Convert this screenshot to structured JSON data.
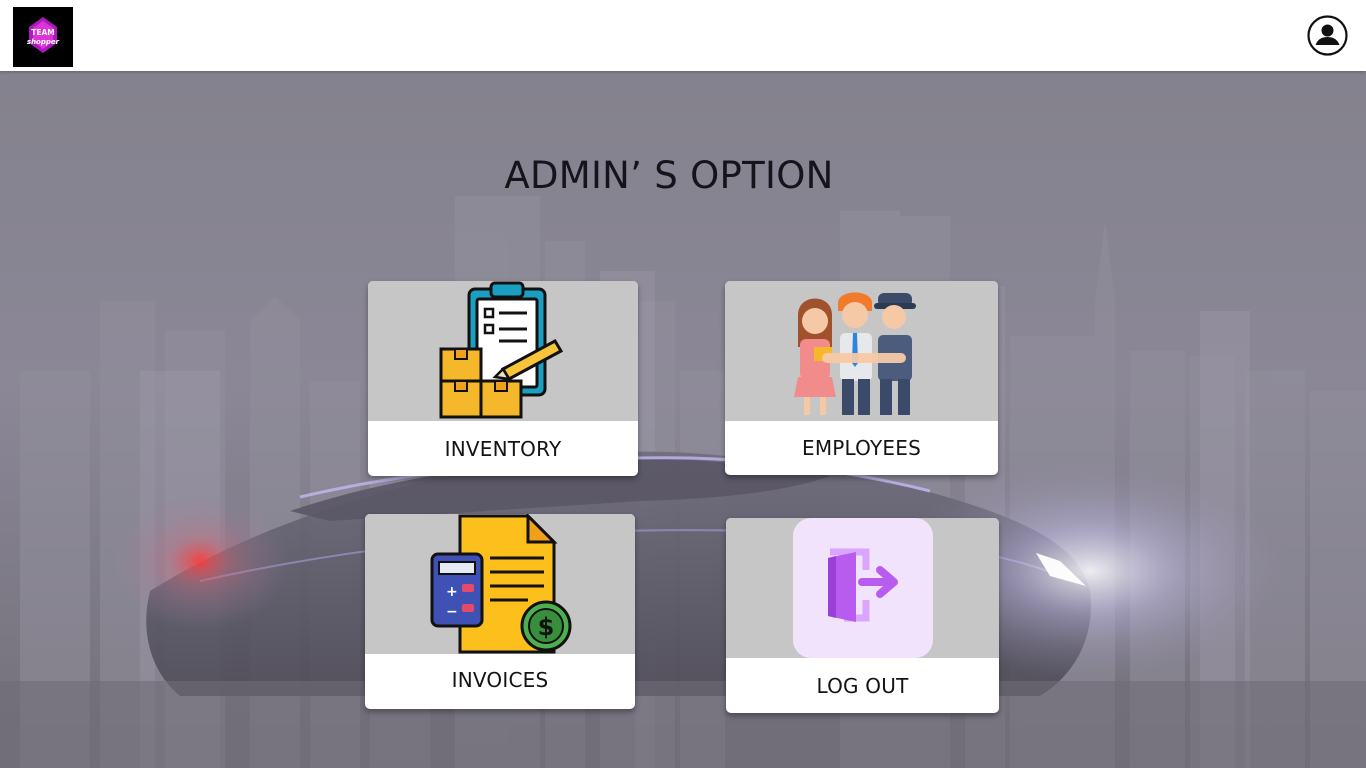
{
  "header": {
    "logo_text_top": "TEAM",
    "logo_text_bottom": "shopper",
    "profile_icon": "user-circle-icon"
  },
  "page": {
    "title": "ADMIN’ S OPTION"
  },
  "options": [
    {
      "key": "inventory",
      "label": "INVENTORY",
      "icon": "clipboard-boxes-icon"
    },
    {
      "key": "employees",
      "label": "EMPLOYEES",
      "icon": "team-people-icon"
    },
    {
      "key": "invoices",
      "label": "INVOICES",
      "icon": "invoice-calculator-icon"
    },
    {
      "key": "logout",
      "label": "LOG OUT",
      "icon": "exit-door-icon"
    }
  ],
  "colors": {
    "header_bg": "#ffffff",
    "card_art_bg": "#c6c6c6",
    "card_label_bg": "#ffffff",
    "logout_tile_bg": "#f2e3fd",
    "logout_accent": "#b063ea"
  }
}
